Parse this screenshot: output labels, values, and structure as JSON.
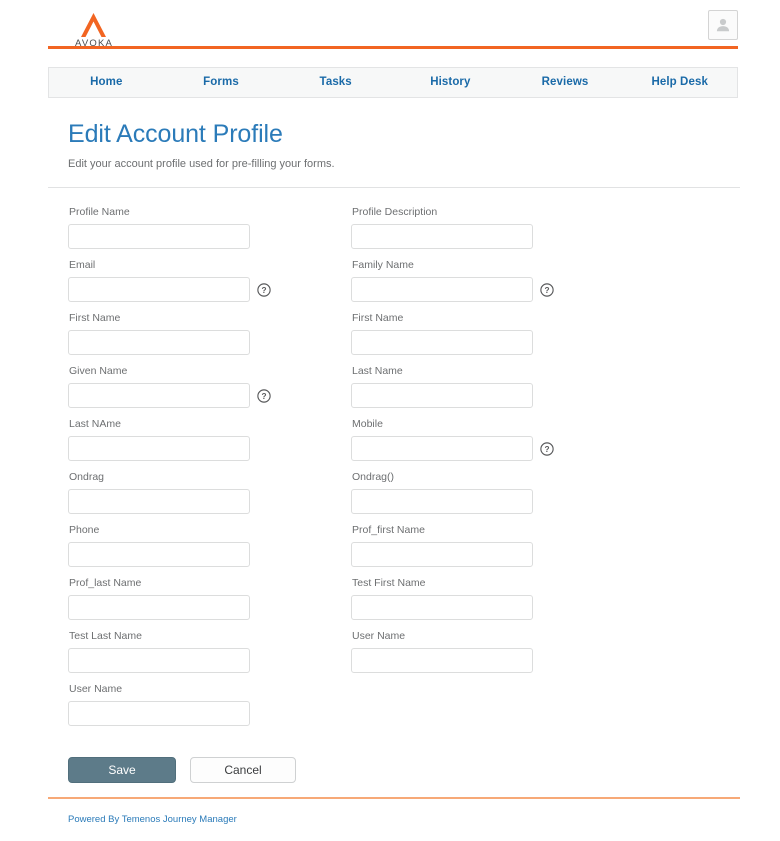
{
  "header": {
    "logo_text": "AVOKA",
    "avatar_icon": "user-avatar-icon"
  },
  "nav": {
    "items": [
      {
        "label": "Home"
      },
      {
        "label": "Forms"
      },
      {
        "label": "Tasks"
      },
      {
        "label": "History"
      },
      {
        "label": "Reviews"
      },
      {
        "label": "Help Desk"
      }
    ]
  },
  "page": {
    "title": "Edit Account Profile",
    "subtitle": "Edit your account profile used for pre-filling your forms."
  },
  "form": {
    "required_marker": "*",
    "left_column": [
      {
        "label": "Profile Name",
        "required": true,
        "value": "",
        "placeholder": "",
        "help": false
      },
      {
        "label": "Email",
        "required": false,
        "value": "",
        "placeholder": "",
        "help": true
      },
      {
        "label": "First Name",
        "required": false,
        "value": "",
        "placeholder": "",
        "help": false
      },
      {
        "label": "Given Name",
        "required": false,
        "value": "",
        "placeholder": "",
        "help": true
      },
      {
        "label": "Last NAme",
        "required": false,
        "value": "",
        "placeholder": "",
        "help": false
      },
      {
        "label": "Ondrag",
        "required": false,
        "value": "",
        "placeholder": "",
        "help": false
      },
      {
        "label": "Phone",
        "required": false,
        "value": "",
        "placeholder": "",
        "help": false
      },
      {
        "label": "Prof_last Name",
        "required": false,
        "value": "",
        "placeholder": "",
        "help": false
      },
      {
        "label": "Test Last Name",
        "required": false,
        "value": "",
        "placeholder": "",
        "help": false
      },
      {
        "label": "User Name",
        "required": false,
        "value": "",
        "placeholder": "",
        "help": false
      }
    ],
    "right_column": [
      {
        "label": "Profile Description",
        "required": false,
        "value": "",
        "placeholder": "",
        "help": false
      },
      {
        "label": "Family Name",
        "required": false,
        "value": "",
        "placeholder": "",
        "help": true
      },
      {
        "label": "First Name",
        "required": false,
        "value": "",
        "placeholder": "",
        "help": false
      },
      {
        "label": "Last Name",
        "required": false,
        "value": "",
        "placeholder": "",
        "help": false
      },
      {
        "label": "Mobile",
        "required": false,
        "value": "",
        "placeholder": "",
        "help": true
      },
      {
        "label": "Ondrag()",
        "required": false,
        "value": "",
        "placeholder": "",
        "help": false
      },
      {
        "label": "Prof_first Name",
        "required": false,
        "value": "",
        "placeholder": "",
        "help": false
      },
      {
        "label": "Test First Name",
        "required": false,
        "value": "",
        "placeholder": "",
        "help": false
      },
      {
        "label": "User Name",
        "required": false,
        "value": "",
        "placeholder": "",
        "help": false
      }
    ]
  },
  "buttons": {
    "save_label": "Save",
    "cancel_label": "Cancel"
  },
  "footer": {
    "powered_by": "Powered By Temenos Journey Manager"
  },
  "colors": {
    "brand_orange": "#f26522",
    "link_blue": "#2b7bb9",
    "nav_blue": "#1a6aa8",
    "save_button": "#5d7b89",
    "required_red": "#e8543f",
    "footer_rule": "#f7a977"
  }
}
